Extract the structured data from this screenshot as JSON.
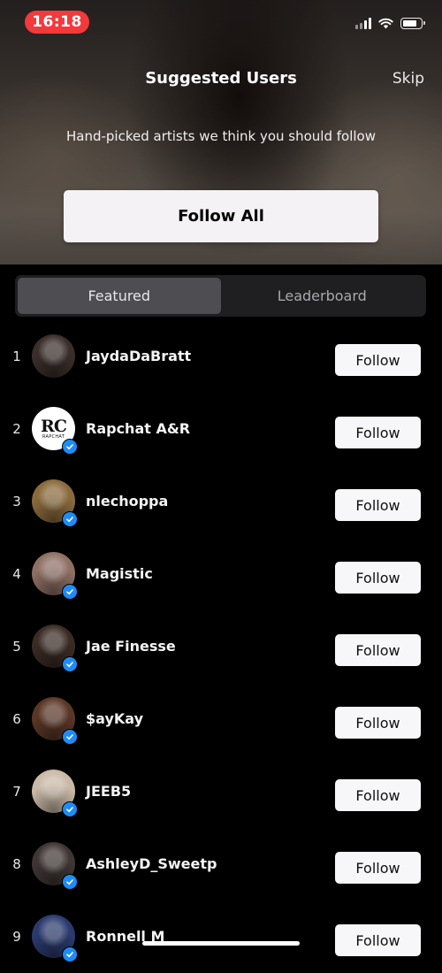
{
  "status_bar": {
    "time": "16:18",
    "time_pill_color": "#f2393b",
    "icons": [
      "signal-icon",
      "wifi-icon",
      "battery-icon"
    ]
  },
  "header": {
    "title": "Suggested Users",
    "skip_label": "Skip",
    "subtitle": "Hand-picked artists we think you should follow",
    "follow_all_label": "Follow All"
  },
  "tabs": [
    {
      "label": "Featured",
      "active": true
    },
    {
      "label": "Leaderboard",
      "active": false
    }
  ],
  "users": [
    {
      "rank": "1",
      "name": "JaydaDaBratt",
      "verified": false,
      "avatar": "photo",
      "avatar_color": "#3a2e2a",
      "follow_label": "Follow"
    },
    {
      "rank": "2",
      "name": "Rapchat A&R",
      "verified": true,
      "avatar": "rc-logo",
      "avatar_text": "RC",
      "avatar_subtext": "RAPCHAT",
      "follow_label": "Follow"
    },
    {
      "rank": "3",
      "name": "nlechoppa",
      "verified": true,
      "avatar": "photo",
      "avatar_color": "#8a6a3c",
      "follow_label": "Follow"
    },
    {
      "rank": "4",
      "name": "Magistic",
      "verified": true,
      "avatar": "photo",
      "avatar_color": "#8e6f63",
      "follow_label": "Follow"
    },
    {
      "rank": "5",
      "name": "Jae Finesse",
      "verified": true,
      "avatar": "photo",
      "avatar_color": "#3b2b25",
      "follow_label": "Follow"
    },
    {
      "rank": "6",
      "name": "$ayKay",
      "verified": true,
      "avatar": "photo",
      "avatar_color": "#5a3626",
      "follow_label": "Follow"
    },
    {
      "rank": "7",
      "name": "JEEB5",
      "verified": true,
      "avatar": "photo",
      "avatar_color": "#c9b9a6",
      "follow_label": "Follow"
    },
    {
      "rank": "8",
      "name": "AshleyD_Sweetp",
      "verified": true,
      "avatar": "photo",
      "avatar_color": "#3f3634",
      "follow_label": "Follow"
    },
    {
      "rank": "9",
      "name": "Ronnell M",
      "verified": true,
      "avatar": "photo",
      "avatar_color": "#2b3a6e",
      "follow_label": "Follow"
    }
  ],
  "colors": {
    "background": "#000000",
    "button_bg": "#f7f6f9",
    "verified_badge": "#1d8cf8",
    "tab_active_bg": "#4d4d52",
    "tab_bar_bg": "#1f1f21"
  }
}
